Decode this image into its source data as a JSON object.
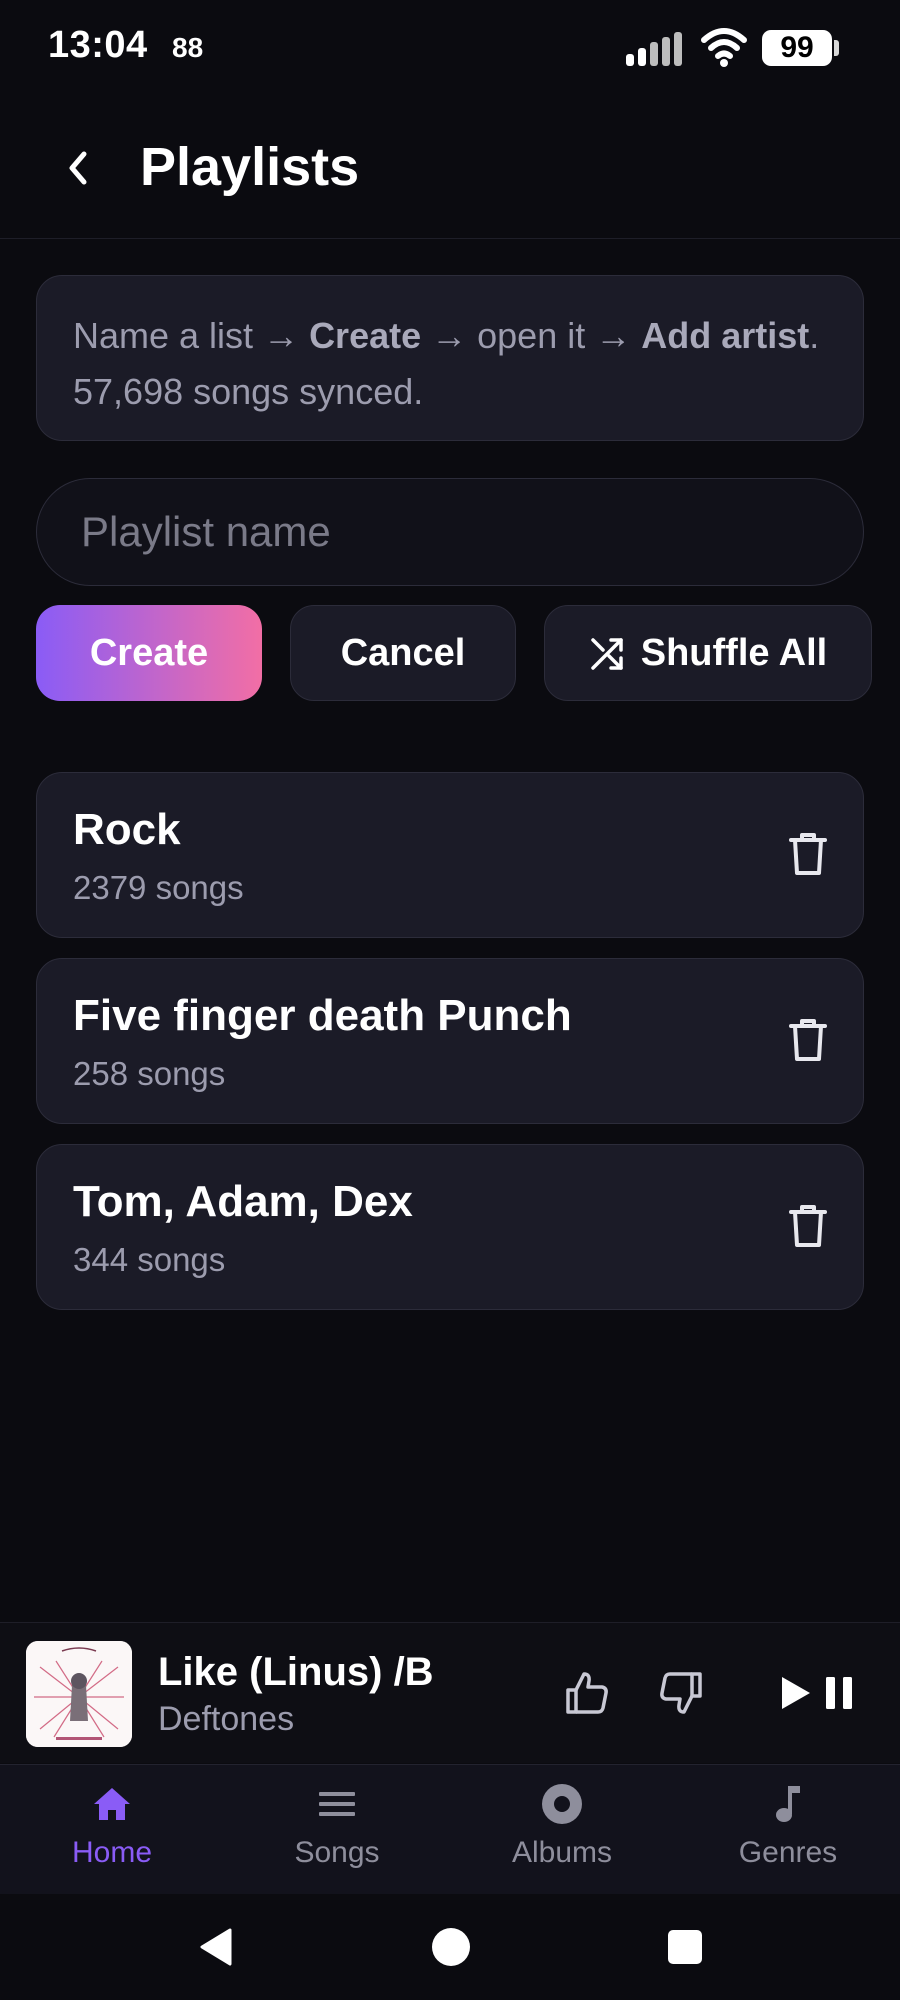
{
  "status_bar": {
    "time": "13:04",
    "extra": "88",
    "battery": "99"
  },
  "header": {
    "title": "Playlists"
  },
  "info": {
    "part1": "Name a list → ",
    "bold1": "Create",
    "part2": " → open it → ",
    "bold2": "Add artist",
    "part3": ". 57,698 songs synced."
  },
  "form": {
    "placeholder": "Playlist name",
    "create_label": "Create",
    "cancel_label": "Cancel",
    "shuffle_label": "Shuffle All"
  },
  "playlists": [
    {
      "name": "Rock",
      "count": "2379 songs"
    },
    {
      "name": "Five finger death Punch",
      "count": "258 songs"
    },
    {
      "name": "Tom, Adam, Dex",
      "count": "344 songs"
    }
  ],
  "player": {
    "title": "Like (Linus) /B",
    "artist": "Deftones"
  },
  "nav": {
    "items": [
      {
        "label": "Home",
        "icon": "home-icon",
        "active": true
      },
      {
        "label": "Songs",
        "icon": "list-icon",
        "active": false
      },
      {
        "label": "Albums",
        "icon": "disc-icon",
        "active": false
      },
      {
        "label": "Genres",
        "icon": "music-note-icon",
        "active": false
      }
    ]
  },
  "colors": {
    "background": "#0b0b10",
    "card": "#1b1b27",
    "accent_start": "#8a5cf6",
    "accent_end": "#f26ea5",
    "muted_text": "#9c9cae"
  }
}
